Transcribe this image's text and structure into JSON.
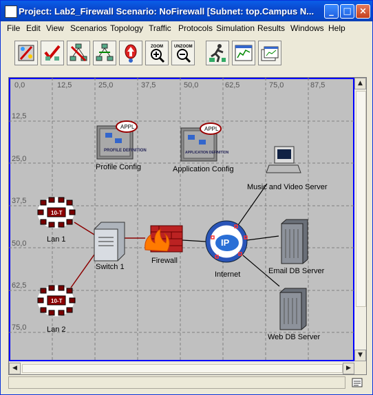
{
  "window": {
    "title": "Project: Lab2_Firewall Scenario: NoFirewall  [Subnet: top.Campus N...",
    "buttons": {
      "minimize": "_",
      "maximize": "□",
      "close": "×"
    }
  },
  "menu": [
    "File",
    "Edit",
    "View",
    "Scenarios",
    "Topology",
    "Traffic",
    "Protocols",
    "Simulation",
    "Results",
    "Windows",
    "Help"
  ],
  "toolbar": {
    "tools": [
      "open-palette",
      "verify-links",
      "fail-nodes",
      "recover-nodes",
      "return-parent",
      "zoom",
      "unzoom",
      "configure-simulation",
      "view-results",
      "hide-graphs"
    ],
    "zoom_label": "ZOOM",
    "unzoom_label": "UNZOOM"
  },
  "canvas": {
    "x_ticks": [
      "0,0",
      "12,5",
      "25,0",
      "37,5",
      "50,0",
      "62,5",
      "75,0",
      "87,5"
    ],
    "y_ticks": [
      "12,5",
      "25,0",
      "37,5",
      "50,0",
      "62,5",
      "75,0"
    ],
    "background": "#c0c0c0",
    "nodes": {
      "profile_config": "Profile Config",
      "application_config": "Application Config",
      "music_server": "Music and Video Server",
      "lan1": "Lan 1",
      "lan2": "Lan 2",
      "switch1": "Switch 1",
      "firewall": "Firewall",
      "internet": "Internet",
      "email_server": "Email DB Server",
      "web_server": "Web DB Server"
    },
    "badge_appl": "APPL",
    "profile_text": "PROFILE DEFINITION",
    "app_text": "APPLICATION DEFINITION",
    "hub_text": "10-T",
    "ip_text": "IP"
  },
  "colors": {
    "link_red": "#8b0000",
    "link_black": "#000000",
    "selection_blue": "#0000ff"
  }
}
